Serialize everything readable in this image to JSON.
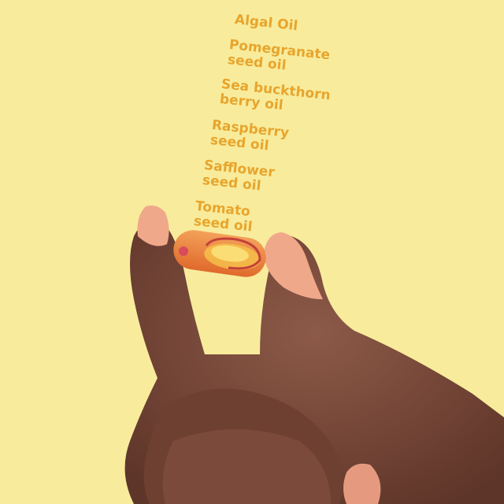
{
  "labels": [
    {
      "lines": [
        "Algal Oil"
      ]
    },
    {
      "lines": [
        "Pomegranate",
        "seed oil"
      ]
    },
    {
      "lines": [
        "Sea buckthorn",
        "berry oil"
      ]
    },
    {
      "lines": [
        "Raspberry",
        "seed oil"
      ]
    },
    {
      "lines": [
        "Safflower",
        "seed oil"
      ]
    },
    {
      "lines": [
        "Tomato",
        "seed oil"
      ]
    }
  ],
  "colors": {
    "background": "#f8ec9c",
    "label_text": "#e8a52d",
    "skin": "#7b4c3e",
    "nail": "#f0a88a",
    "capsule": "#ea7a3a"
  }
}
